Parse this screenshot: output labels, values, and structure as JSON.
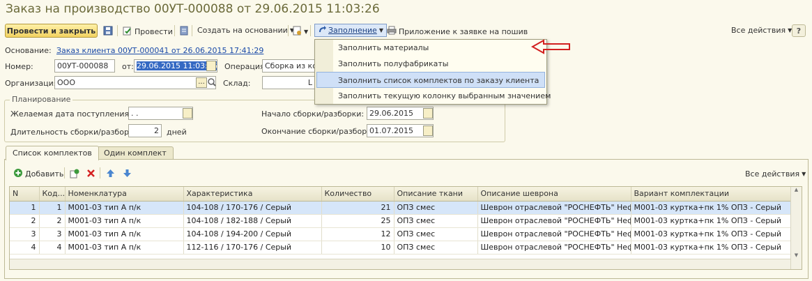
{
  "window": {
    "title": "Заказ на производство 00УТ-000088 от 29.06.2015 11:03:26"
  },
  "toolbar": {
    "post_close": "Провести и закрыть",
    "post": "Провести",
    "create_based": "Создать на основании",
    "fill": "Заполнение",
    "attachment": "Приложение к заявке на пошив",
    "all_actions": "Все действия"
  },
  "fill_menu": {
    "items": [
      "Заполнить материалы",
      "Заполнить полуфабрикаты",
      "Заполнить список комплектов по заказу клиента",
      "Заполнить текущую колонку выбранным значением"
    ],
    "highlighted_index": 2
  },
  "form": {
    "basis_label": "Основание:",
    "basis_link": "Заказ клиента 00УТ-000041 от 26.06.2015 17:41:29",
    "number_label": "Номер:",
    "number_value": "00УТ-000088",
    "from_label": "от:",
    "date_value": "29.06.2015 11:03:26",
    "operation_label": "Операция:",
    "operation_value": "Сборка из ком",
    "org_label": "Организация:",
    "org_value": "ООО",
    "org_button": "...",
    "warehouse_label": "Склад:",
    "warehouse_value": "L"
  },
  "planning": {
    "title": "Планирование",
    "desired_date_label": "Желаемая дата поступления:",
    "desired_date_value": " .  .",
    "duration_label": "Длительность сборки/разборки:",
    "duration_value": "2",
    "duration_unit": "дней",
    "start_label": "Начало сборки/разборки:",
    "start_value": "29.06.2015",
    "end_label": "Окончание сборки/разборки:",
    "end_value": "01.07.2015"
  },
  "tabs": [
    {
      "label": "Список комплектов",
      "active": true
    },
    {
      "label": "Один комплект",
      "active": false
    }
  ],
  "table_toolbar": {
    "add": "Добавить",
    "all_actions": "Все действия"
  },
  "table": {
    "columns": [
      "N",
      "Код...",
      "Номенклатура",
      "Характеристика",
      "Количество",
      "Описание ткани",
      "Описание шеврона",
      "Вариант комплектации"
    ],
    "rows": [
      [
        "1",
        "1",
        "М001-03 тип А п/к",
        "104-108 / 170-176 / Серый",
        "21",
        "ОПЗ смес",
        "Шеврон отраслевой \"РОСНЕФТЬ\" Неф...",
        "М001-03  куртка+пк  1% ОПЗ - Серый"
      ],
      [
        "2",
        "2",
        "М001-03 тип А п/к",
        "104-108 / 182-188 / Серый",
        "25",
        "ОПЗ смес",
        "Шеврон отраслевой \"РОСНЕФТЬ\" Неф...",
        "М001-03  куртка+пк  1% ОПЗ - Серый"
      ],
      [
        "3",
        "3",
        "М001-03 тип А п/к",
        "104-108 / 194-200 / Серый",
        "12",
        "ОПЗ смес",
        "Шеврон отраслевой \"РОСНЕФТЬ\" Неф...",
        "М001-03  куртка+пк  1% ОПЗ - Серый"
      ],
      [
        "4",
        "4",
        "М001-03 тип А п/к",
        "112-116 / 170-176 / Серый",
        "10",
        "ОПЗ смес",
        "Шеврон отраслевой \"РОСНЕФТЬ\" Неф...",
        "М001-03  куртка+пк  1% ОПЗ - Серый"
      ]
    ],
    "selected_row": 0
  },
  "colors": {
    "background": "#fbf9ec",
    "primary_button": "#f2d261",
    "link": "#1a4aa8",
    "selection": "#d6e6f9",
    "arrow": "#d22020"
  }
}
